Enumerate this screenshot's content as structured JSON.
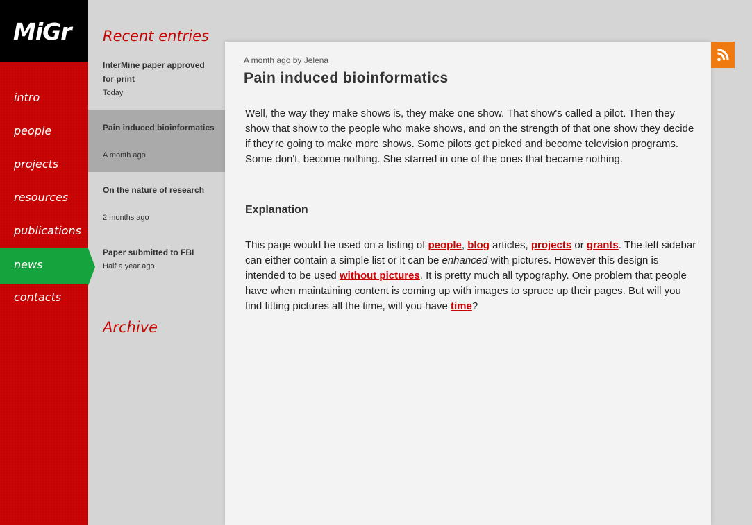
{
  "logo": "MiGr",
  "nav": [
    "intro",
    "people",
    "projects",
    "resources",
    "publications",
    "news",
    "contacts"
  ],
  "nav_active": "news",
  "sidebar": {
    "recent_heading": "Recent entries",
    "archive_heading": "Archive",
    "entries": [
      {
        "title": "InterMine paper approved for print",
        "date": "Today"
      },
      {
        "title": "Pain induced bioinformatics",
        "date": "A month ago"
      },
      {
        "title": "On the nature of research",
        "date": "2 months ago"
      },
      {
        "title": "Paper submitted to FBI",
        "date": "Half a year ago"
      }
    ]
  },
  "article": {
    "meta": "A month ago by Jelena",
    "title": "Pain induced bioinformatics",
    "intro": "Well, the way they make shows is, they make one show. That show's called a pilot. Then they show that show to the people who make shows, and on the strength of that one show they decide if they're going to make more shows. Some pilots get picked and become television programs. Some don't, become nothing. She starred in one of the ones that became nothing.",
    "subheading": "Explanation",
    "explanation": {
      "t1": "This page would be used on a listing of ",
      "l1": "people",
      "t2": ", ",
      "l2": "blog",
      "t3": " articles, ",
      "l3": "projects",
      "t4": " or ",
      "l4": "grants",
      "t5": ". The left sidebar can either contain a simple list or it can be ",
      "em": "enhanced",
      "t6": " with pictures. However this design is intended to be used ",
      "l5": "without pictures",
      "t7": ". It is pretty much all typography. One problem that people have when maintaining content is coming up with images to spruce up their pages. But will you find fitting pictures all the time, will you have ",
      "l6": "time",
      "t8": "?"
    }
  },
  "icons": {
    "rss": "rss-icon"
  },
  "colors": {
    "brand_red": "#c90404",
    "active_green": "#14a33d",
    "rss_orange": "#f07a12"
  }
}
